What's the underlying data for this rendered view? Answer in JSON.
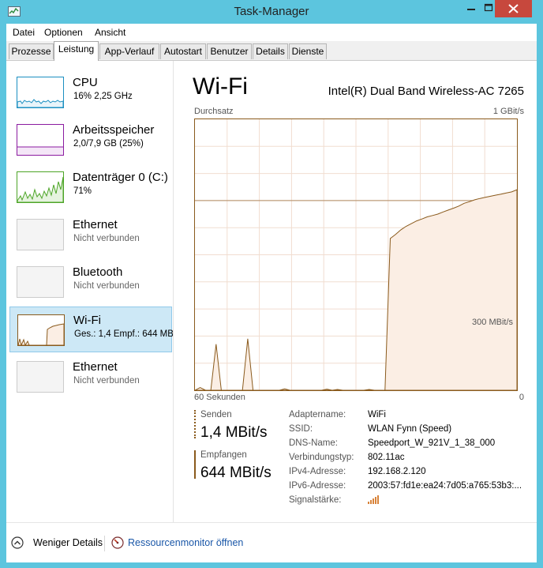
{
  "window": {
    "title": "Task-Manager"
  },
  "menu": [
    "Datei",
    "Optionen",
    "Ansicht"
  ],
  "tabs": [
    "Prozesse",
    "Leistung",
    "App-Verlauf",
    "Autostart",
    "Benutzer",
    "Details",
    "Dienste"
  ],
  "active_tab": "Leistung",
  "sidebar": [
    {
      "title": "CPU",
      "sub": "16% 2,25 GHz",
      "color": "#1b8fc1"
    },
    {
      "title": "Arbeitsspeicher",
      "sub": "2,0/7,9 GB (25%)",
      "color": "#8b1ba0"
    },
    {
      "title": "Datenträger 0 (C:)",
      "sub": "71%",
      "color": "#4da527"
    },
    {
      "title": "Ethernet",
      "sub": "Nicht verbunden",
      "color": "#a0a0a0"
    },
    {
      "title": "Bluetooth",
      "sub": "Nicht verbunden",
      "color": "#a0a0a0"
    },
    {
      "title": "Wi-Fi",
      "sub": "Ges.: 1,4 Empf.: 644 MB",
      "color": "#8a5a1c"
    },
    {
      "title": "Ethernet",
      "sub": "Nicht verbunden",
      "color": "#a0a0a0"
    }
  ],
  "detail": {
    "title": "Wi-Fi",
    "device": "Intel(R) Dual Band Wireless-AC 7265",
    "throughput_label": "Durchsatz",
    "max_label": "1 GBit/s",
    "mid_label": "300 MBit/s",
    "time_left": "60 Sekunden",
    "time_right": "0",
    "send_label": "Senden",
    "send_value": "1,4 MBit/s",
    "recv_label": "Empfangen",
    "recv_value": "644 MBit/s",
    "properties": [
      {
        "key": "Adaptername:",
        "value": "WiFi"
      },
      {
        "key": "SSID:",
        "value": "WLAN Fynn (Speed)"
      },
      {
        "key": "DNS-Name:",
        "value": "Speedport_W_921V_1_38_000"
      },
      {
        "key": "Verbindungstyp:",
        "value": "802.11ac"
      },
      {
        "key": "IPv4-Adresse:",
        "value": "192.168.2.120"
      },
      {
        "key": "IPv6-Adresse:",
        "value": "2003:57:fd1e:ea24:7d05:a765:53b3:..."
      },
      {
        "key": "Signalstärke:",
        "value": ""
      }
    ]
  },
  "footer": {
    "fewer": "Weniger Details",
    "resmon": "Ressourcenmonitor öffnen"
  },
  "colors": {
    "accent": "#8a5a1c",
    "fill": "#fbeee4",
    "grid": "#f1ddd0",
    "selected": "#cde8f6",
    "titlebar": "#5cc5de",
    "close": "#c7483d",
    "link": "#1a57a8"
  },
  "chart_data": {
    "type": "area",
    "unit": "MBit/s",
    "ylim": [
      0,
      1000
    ],
    "x_range": [
      60,
      0
    ],
    "values": [
      0,
      0,
      0,
      0,
      0,
      0,
      0,
      0,
      0,
      0,
      0,
      0,
      0,
      0,
      0,
      0,
      0,
      0,
      0,
      0,
      0,
      0,
      0,
      0,
      0,
      0,
      0,
      0,
      0,
      0,
      0,
      0,
      0,
      0,
      0,
      0,
      0,
      560,
      575,
      592,
      605,
      615,
      625,
      632,
      640,
      645,
      650,
      658,
      665,
      672,
      680,
      690,
      696,
      703,
      708,
      712,
      716,
      720,
      724,
      728,
      732,
      740
    ]
  }
}
